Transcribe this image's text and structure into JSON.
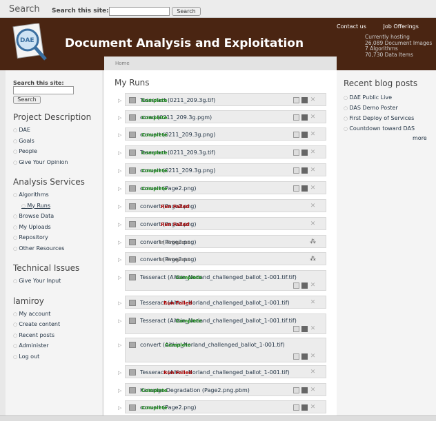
{
  "topbar": {
    "label": "Search",
    "site_label": "Search this site:",
    "button": "Search"
  },
  "header": {
    "logo_text": "DAE",
    "title": "Document Analysis and Exploitation",
    "links": [
      "Contact us",
      "Job Offerings"
    ],
    "stats": [
      "Currently hosting",
      "26,089 Document Images",
      "7 Algorithms",
      "70,730 Data Items"
    ]
  },
  "left": {
    "search_label": "Search this site:",
    "search_button": "Search",
    "sections": [
      {
        "title": "Project Description",
        "items": [
          "DAE",
          "Goals",
          "People",
          "Give Your Opinion"
        ]
      },
      {
        "title": "Analysis Services",
        "items": [
          "Algorithms",
          "My Runs",
          "Browse Data",
          "My Uploads",
          "Repository",
          "Other Resources"
        ]
      },
      {
        "title": "Technical Issues",
        "items": [
          "Give Your Input"
        ]
      },
      {
        "title": "lamiroy",
        "items": [
          "My account",
          "Create content",
          "Recent posts",
          "Administer",
          "Log out"
        ]
      }
    ]
  },
  "main": {
    "breadcrumb": "Home",
    "title": "My Runs",
    "runs": [
      {
        "name": "Tesseract (0211_209.3g.tif)",
        "status": "Complete"
      },
      {
        "name": "ocrad (0211_209.3g.pgm)",
        "status": "Complete"
      },
      {
        "name": "convert (0211_209.3g.png)",
        "status": "Complete"
      },
      {
        "name": "Tesseract (0211_209.3g.tif)",
        "status": "Complete"
      },
      {
        "name": "convert (0211_209.3g.png)",
        "status": "Complete"
      },
      {
        "name": "convert (Page2.png)",
        "status": "Complete"
      },
      {
        "name": "convert (Page2.png)",
        "status": "Run Failed"
      },
      {
        "name": "convert (Page2.png)",
        "status": "Run Failed"
      },
      {
        "name": "convert (Page2.png)",
        "status": "In Progress"
      },
      {
        "name": "convert (Page2.png)",
        "status": "In Progress"
      },
      {
        "name": "Tesseract (Aitkin_Norland_challenged_ballot_1-001.tif.tif)",
        "status": "Complete"
      },
      {
        "name": "Tesseract (Aitkin_Norland_challenged_ballot_1-001.tif)",
        "status": "Run Failed"
      },
      {
        "name": "Tesseract (Aitkin_Norland_challenged_ballot_1-001.tif.tif)",
        "status": "Complete"
      },
      {
        "name": "convert (Aitkin_Norland_challenged_ballot_1-001.tif)",
        "status": "Complete"
      },
      {
        "name": "Tesseract (Aitkin_Norland_challenged_ballot_1-001.tif)",
        "status": "Run Failed"
      },
      {
        "name": "Kanungo Degradation (Page2.png.pbm)",
        "status": "Complete"
      },
      {
        "name": "convert (Page2.png)",
        "status": "Complete"
      }
    ]
  },
  "right": {
    "title": "Recent blog posts",
    "items": [
      "DAE Public Live",
      "DAS Demo Poster",
      "First Deploy of Services",
      "Countdown toward DAS"
    ],
    "more": "more"
  },
  "colors": {
    "header": "#4a2512",
    "complete": "#1a8a1a",
    "failed": "#a00000"
  }
}
